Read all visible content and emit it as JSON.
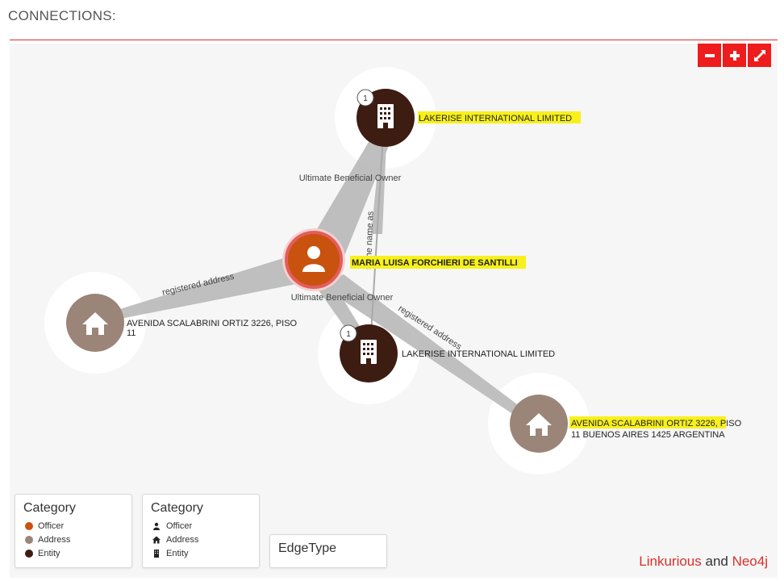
{
  "header": {
    "title": "CONNECTIONS:"
  },
  "zoom": {
    "out_icon": "minus-icon",
    "in_icon": "plus-icon",
    "expand_icon": "expand-icon"
  },
  "nodes": {
    "entity_top": {
      "name": "LAKERISE INTERNATIONAL LIMITED",
      "badge": "1",
      "icon": "building-icon"
    },
    "officer": {
      "name": "MARIA LUISA FORCHIERI DE SANTILLI",
      "icon": "user-icon"
    },
    "address_left": {
      "line1": "AVENIDA SCALABRINI ORTIZ 3226, PISO",
      "line2": "11",
      "icon": "home-icon"
    },
    "entity_mid": {
      "name": "LAKERISE INTERNATIONAL LIMITED",
      "badge": "1",
      "icon": "building-icon"
    },
    "address_right": {
      "line1_highlight": "AVENIDA SCALABRINI ORTIZ 3226,",
      "line1_rest": " PISO",
      "line2": "11 BUENOS AIRES 1425 ARGENTINA",
      "icon": "home-icon"
    }
  },
  "edges": {
    "ubo_top": "Ultimate Beneficial Owner",
    "same_name": "same name as",
    "registered_left": "registered address",
    "ubo_mid": "Ultimate Beneficial Owner",
    "registered_right": "registered address"
  },
  "legend_color": {
    "title": "Category",
    "items": [
      {
        "label": "Officer",
        "color": "#c8520e"
      },
      {
        "label": "Address",
        "color": "#9a8578"
      },
      {
        "label": "Entity",
        "color": "#3d1c12"
      }
    ]
  },
  "legend_icon": {
    "title": "Category",
    "items": [
      {
        "label": "Officer",
        "icon": "user-icon"
      },
      {
        "label": "Address",
        "icon": "home-icon"
      },
      {
        "label": "Entity",
        "icon": "building-icon"
      }
    ]
  },
  "legend_edge": {
    "title": "EdgeType"
  },
  "credit": {
    "part1": "Linkurious",
    "and": " and ",
    "part2": "Neo4j"
  },
  "colors": {
    "officer": "#c8520e",
    "address": "#9a8578",
    "entity": "#3d1c12",
    "highlight": "#f7f01c",
    "accent_red": "#ee1c1c"
  }
}
